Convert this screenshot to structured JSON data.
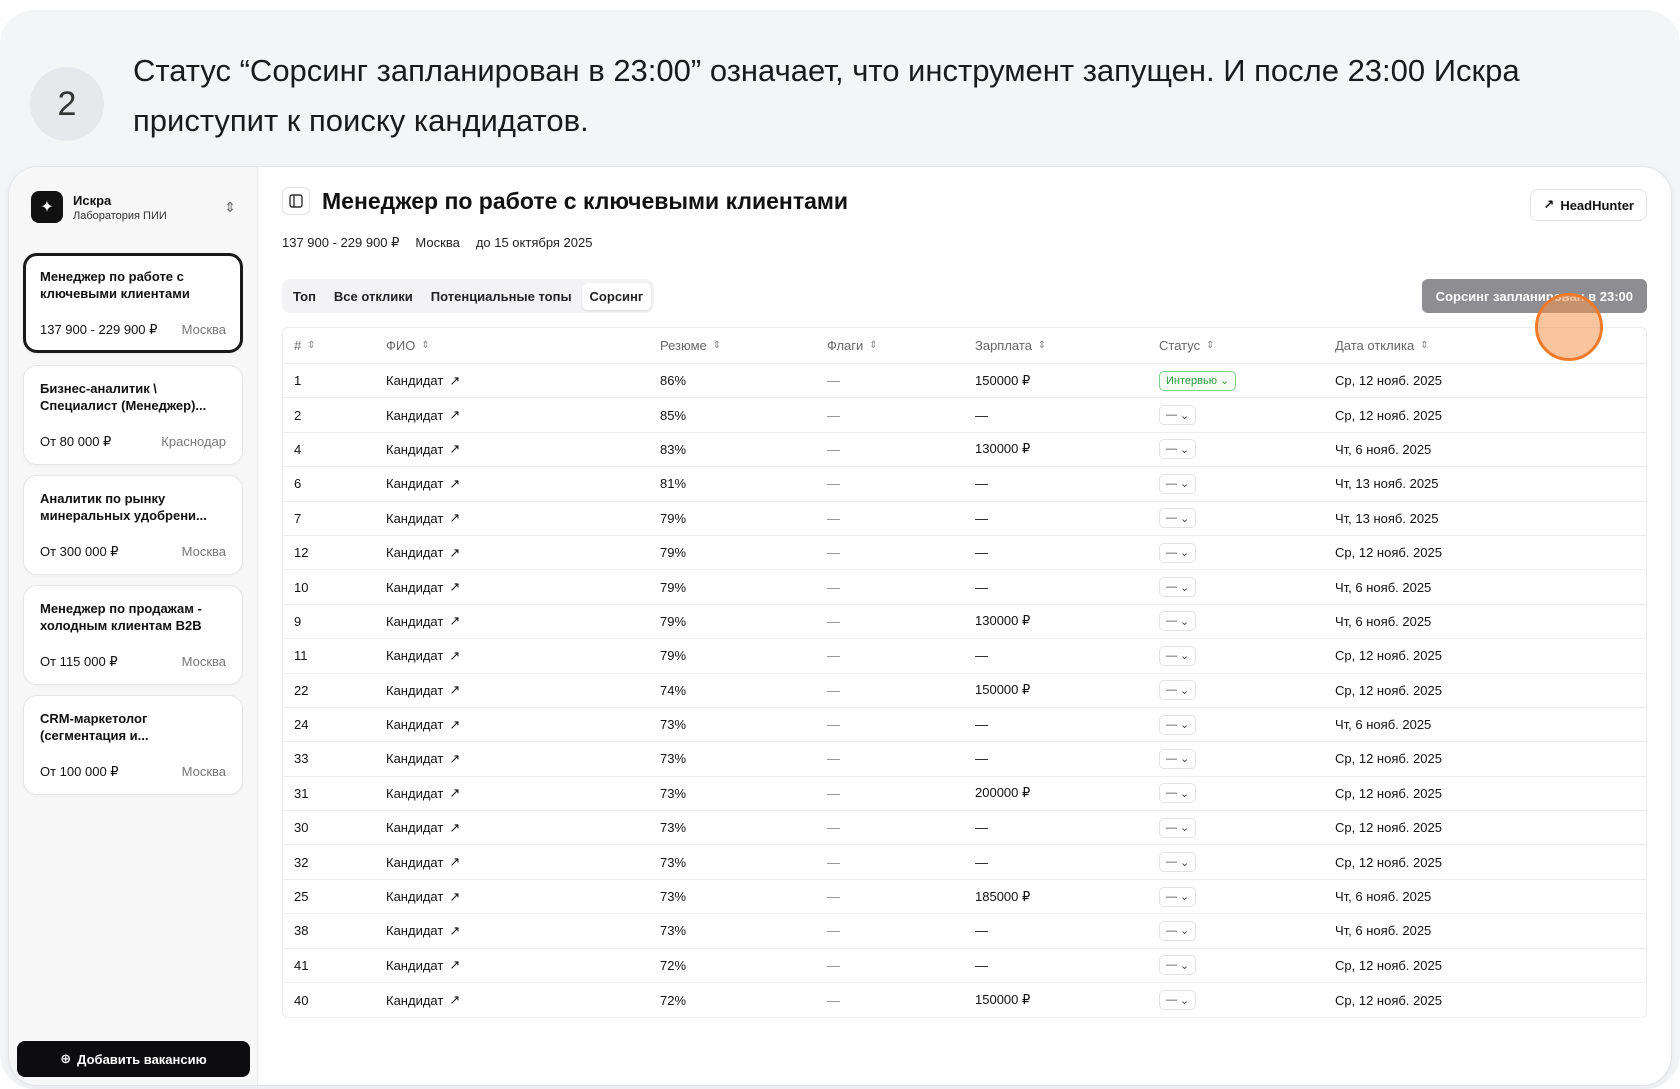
{
  "step": {
    "number": "2",
    "text": "Статус “Сорсинг запланирован в 23:00” означает, что инструмент запущен. И после 23:00 Искра приступит к поиску кандидатов."
  },
  "sidebar": {
    "org_name": "Искра",
    "org_sub": "Лаборатория ПИИ",
    "vacancies": [
      {
        "title": "Менеджер по работе с ключевыми клиентами",
        "salary": "137 900 - 229 900 ₽",
        "city": "Москва",
        "active": true
      },
      {
        "title": "Бизнес-аналитик \\ Специалист (Менеджер)...",
        "salary": "От 80 000 ₽",
        "city": "Краснодар"
      },
      {
        "title": "Аналитик по рынку минеральных удобрени...",
        "salary": "От 300 000 ₽",
        "city": "Москва"
      },
      {
        "title": "Менеджер по продажам - холодным клиентам B2B",
        "salary": "От 115 000 ₽",
        "city": "Москва"
      },
      {
        "title": "CRM-маркетолог (сегментация и...",
        "salary": "От 100 000 ₽",
        "city": "Москва"
      }
    ],
    "add_button": "Добавить вакансию"
  },
  "main": {
    "title": "Менеджер по работе с ключевыми клиентами",
    "hh_button": "HeadHunter",
    "meta": {
      "salary": "137 900 - 229 900 ₽",
      "city": "Москва",
      "deadline": "до 15 октября 2025"
    },
    "tabs": [
      "Топ",
      "Все отклики",
      "Потенциальные топы",
      "Сорсинг"
    ],
    "active_tab": "Сорсинг",
    "sourcing_status": "Сорсинг запланирован в 23:00"
  },
  "table": {
    "headers": [
      "#",
      "ФИО",
      "Резюме",
      "Флаги",
      "Зарплата",
      "Статус",
      "Дата отклика"
    ],
    "rows": [
      {
        "n": "1",
        "name": "Кандидат",
        "resume": "86%",
        "flags": "—",
        "salary": "150000 ₽",
        "status": "Интервью",
        "date": "Ср, 12 нояб. 2025"
      },
      {
        "n": "2",
        "name": "Кандидат",
        "resume": "85%",
        "flags": "—",
        "salary": "—",
        "status": "—",
        "date": "Ср, 12 нояб. 2025"
      },
      {
        "n": "4",
        "name": "Кандидат",
        "resume": "83%",
        "flags": "—",
        "salary": "130000 ₽",
        "status": "—",
        "date": "Чт, 6 нояб. 2025"
      },
      {
        "n": "6",
        "name": "Кандидат",
        "resume": "81%",
        "flags": "—",
        "salary": "—",
        "status": "—",
        "date": "Чт, 13 нояб. 2025"
      },
      {
        "n": "7",
        "name": "Кандидат",
        "resume": "79%",
        "flags": "—",
        "salary": "—",
        "status": "—",
        "date": "Чт, 13 нояб. 2025"
      },
      {
        "n": "12",
        "name": "Кандидат",
        "resume": "79%",
        "flags": "—",
        "salary": "—",
        "status": "—",
        "date": "Ср, 12 нояб. 2025"
      },
      {
        "n": "10",
        "name": "Кандидат",
        "resume": "79%",
        "flags": "—",
        "salary": "—",
        "status": "—",
        "date": "Чт, 6 нояб. 2025"
      },
      {
        "n": "9",
        "name": "Кандидат",
        "resume": "79%",
        "flags": "—",
        "salary": "130000 ₽",
        "status": "—",
        "date": "Чт, 6 нояб. 2025"
      },
      {
        "n": "11",
        "name": "Кандидат",
        "resume": "79%",
        "flags": "—",
        "salary": "—",
        "status": "—",
        "date": "Ср, 12 нояб. 2025"
      },
      {
        "n": "22",
        "name": "Кандидат",
        "resume": "74%",
        "flags": "—",
        "salary": "150000 ₽",
        "status": "—",
        "date": "Ср, 12 нояб. 2025"
      },
      {
        "n": "24",
        "name": "Кандидат",
        "resume": "73%",
        "flags": "—",
        "salary": "—",
        "status": "—",
        "date": "Чт, 6 нояб. 2025"
      },
      {
        "n": "33",
        "name": "Кандидат",
        "resume": "73%",
        "flags": "—",
        "salary": "—",
        "status": "—",
        "date": "Ср, 12 нояб. 2025"
      },
      {
        "n": "31",
        "name": "Кандидат",
        "resume": "73%",
        "flags": "—",
        "salary": "200000 ₽",
        "status": "—",
        "date": "Ср, 12 нояб. 2025"
      },
      {
        "n": "30",
        "name": "Кандидат",
        "resume": "73%",
        "flags": "—",
        "salary": "—",
        "status": "—",
        "date": "Ср, 12 нояб. 2025"
      },
      {
        "n": "32",
        "name": "Кандидат",
        "resume": "73%",
        "flags": "—",
        "salary": "—",
        "status": "—",
        "date": "Ср, 12 нояб. 2025"
      },
      {
        "n": "25",
        "name": "Кандидат",
        "resume": "73%",
        "flags": "—",
        "salary": "185000 ₽",
        "status": "—",
        "date": "Чт, 6 нояб. 2025"
      },
      {
        "n": "38",
        "name": "Кандидат",
        "resume": "73%",
        "flags": "—",
        "salary": "—",
        "status": "—",
        "date": "Чт, 6 нояб. 2025"
      },
      {
        "n": "41",
        "name": "Кандидат",
        "resume": "72%",
        "flags": "—",
        "salary": "—",
        "status": "—",
        "date": "Ср, 12 нояб. 2025"
      },
      {
        "n": "40",
        "name": "Кандидат",
        "resume": "72%",
        "flags": "—",
        "salary": "150000 ₽",
        "status": "—",
        "date": "Ср, 12 нояб. 2025"
      }
    ]
  },
  "colors": {
    "accent": "#ef7a2a",
    "status_green": "#2d9d3b",
    "sidebar_bg": "#f7f7f8"
  },
  "icons": {
    "logo": "sparkle-icon",
    "external": "external-link-icon",
    "sort": "sort-icon",
    "chevron": "chevron-down-icon",
    "plus": "plus-circle-icon",
    "panel": "sidebar-panel-icon"
  }
}
